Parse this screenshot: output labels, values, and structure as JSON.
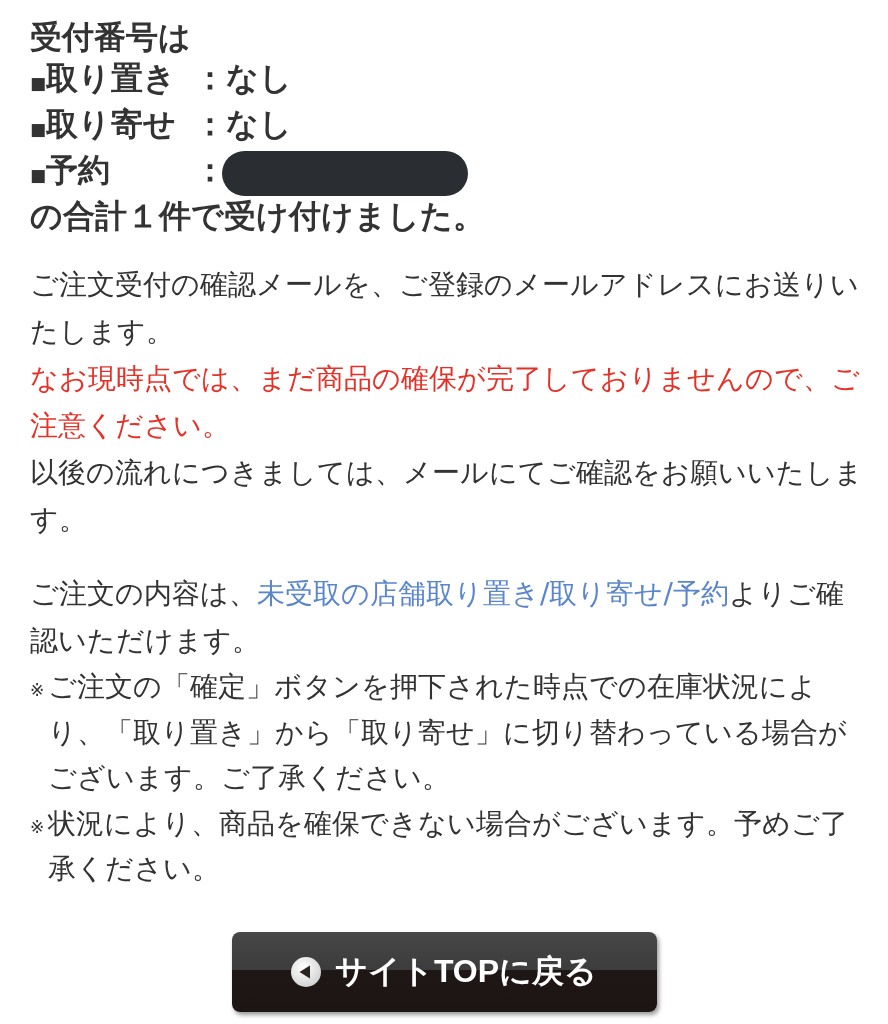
{
  "confirmation": {
    "heading": "受付番号は",
    "items": [
      {
        "bullet": "■",
        "label": "取り置き",
        "separator": "：",
        "value": "なし",
        "redacted": false
      },
      {
        "bullet": "■",
        "label": "取り寄せ",
        "separator": "：",
        "value": "なし",
        "redacted": false
      },
      {
        "bullet": "■",
        "label": "予約",
        "separator": "：",
        "redacted": true
      }
    ],
    "summary": "の合計１件で受け付けました。"
  },
  "messages": [
    {
      "kind": "normal",
      "text": "ご注文受付の確認メールを、ご登録のメールアドレスにお送りいたします。"
    },
    {
      "kind": "warning",
      "text": "なお現時点では、まだ商品の確保が完了しておりませんので、ご注意ください。"
    },
    {
      "kind": "normal",
      "text": "以後の流れにつきましては、メールにてご確認をお願いいたします。"
    }
  ],
  "details": {
    "before": "ご注文の内容は、",
    "link": "未受取の店舗取り置き/取り寄せ/予約",
    "after": "よりご確認いただけます。"
  },
  "notes": [
    {
      "marker": "※",
      "text": "ご注文の「確定」ボタンを押下された時点での在庫状況により、「取り置き」から「取り寄せ」に切り替わっている場合がございます。ご了承ください。"
    },
    {
      "marker": "※",
      "text": "状況により、商品を確保できない場合がございます。予めご了承ください。"
    }
  ],
  "back_button": {
    "label": "サイトTOPに戻る"
  }
}
